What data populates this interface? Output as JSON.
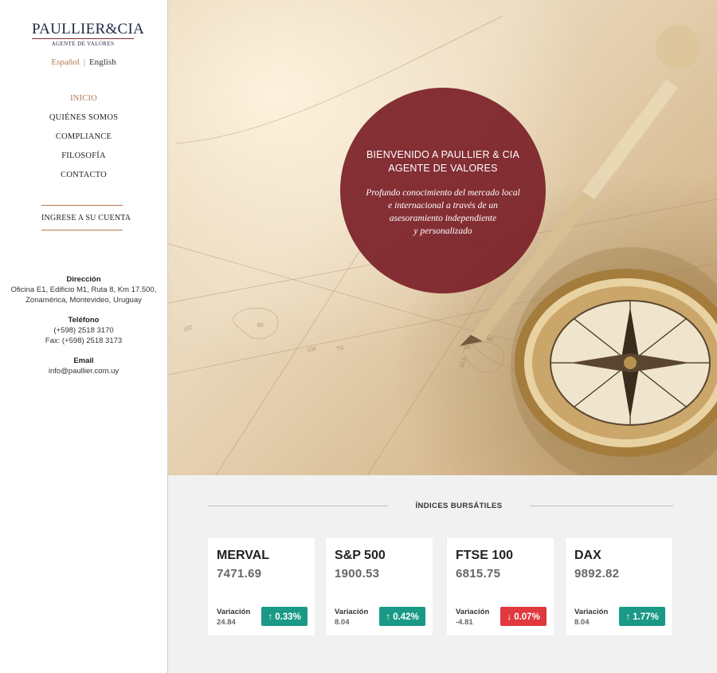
{
  "brand": {
    "name": "PAULLIER&CIA",
    "tagline": "AGENTE DE VALORES"
  },
  "languages": {
    "active": "Español",
    "separator": "|",
    "other": "English"
  },
  "nav": [
    {
      "label": "INICIO",
      "active": true
    },
    {
      "label": "QUIÉNES SOMOS",
      "active": false
    },
    {
      "label": "COMPLIANCE",
      "active": false
    },
    {
      "label": "FILOSOFÍA",
      "active": false
    },
    {
      "label": "CONTACTO",
      "active": false
    }
  ],
  "account_link": "INGRESE A SU CUENTA",
  "contact": {
    "address_label": "Dirección",
    "address": "Oficina E1, Edificio M1, Ruta 8, Km 17.500, Zonamérica, Montevideo, Uruguay",
    "phone_label": "Teléfono",
    "phone": "(+598) 2518 3170",
    "fax": "Fax: (+598) 2518 3173",
    "email_label": "Email",
    "email": "info@paullier.com.uy"
  },
  "hero": {
    "title_line1": "BIENVENIDO A PAULLIER & CIA",
    "title_line2": "AGENTE DE VALORES",
    "description": "Profundo conocimiento del mercado local\ne internacional a través de un\nasesoramiento independiente\ny personalizado"
  },
  "indices": {
    "heading": "ÍNDICES BURSÁTILES",
    "variation_label": "Variación",
    "colors": {
      "up": "#1a9a86",
      "down": "#e0393e"
    },
    "items": [
      {
        "name": "MERVAL",
        "value": "7471.69",
        "variation": "24.84",
        "change": "0.33%",
        "direction": "up",
        "arrow": "↑"
      },
      {
        "name": "S&P 500",
        "value": "1900.53",
        "variation": "8.04",
        "change": "0.42%",
        "direction": "up",
        "arrow": "↑"
      },
      {
        "name": "FTSE 100",
        "value": "6815.75",
        "variation": "-4.81",
        "change": "0.07%",
        "direction": "down",
        "arrow": "↓"
      },
      {
        "name": "DAX",
        "value": "9892.82",
        "variation": "8.04",
        "change": "1.77%",
        "direction": "up",
        "arrow": "↑"
      }
    ]
  },
  "accent_color": "#7a1f27",
  "nav_active_color": "#b07850"
}
